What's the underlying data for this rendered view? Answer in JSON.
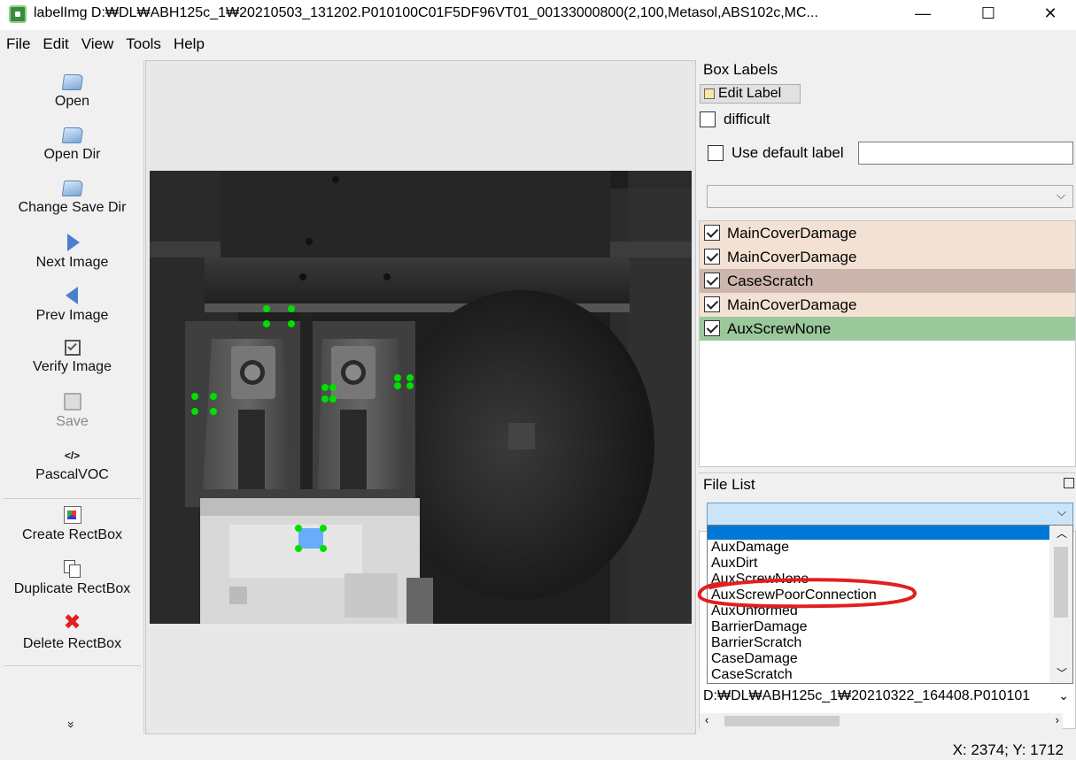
{
  "window": {
    "title": "labelImg D:₩DL₩ABH125c_1₩20210503_131202.P010100C01F5DF96VT01_00133000800(2,100,Metasol,ABS102c,MC...",
    "minimize": "—",
    "maximize": "☐",
    "close": "✕"
  },
  "menu": [
    "File",
    "Edit",
    "View",
    "Tools",
    "Help"
  ],
  "toolbar": {
    "open": "Open",
    "open_dir": "Open Dir",
    "change_save_dir": "Change Save Dir",
    "next_image": "Next Image",
    "prev_image": "Prev Image",
    "verify_image": "Verify Image",
    "save": "Save",
    "format_icon": "</>",
    "format": "PascalVOC",
    "create_rectbox": "Create RectBox",
    "duplicate_rectbox": "Duplicate RectBox",
    "delete_rectbox": "Delete RectBox",
    "expand": "»"
  },
  "box_labels": {
    "title": "Box Labels",
    "edit_label": "Edit Label",
    "difficult": "difficult",
    "use_default_label": "Use default label",
    "default_label_value": "",
    "labels": [
      {
        "text": "MainCoverDamage",
        "checked": true,
        "color": "#f3e2d4"
      },
      {
        "text": "MainCoverDamage",
        "checked": true,
        "color": "#f3e2d4"
      },
      {
        "text": "CaseScratch",
        "checked": true,
        "color": "#cbb5ad"
      },
      {
        "text": "MainCoverDamage",
        "checked": true,
        "color": "#f3e2d4"
      },
      {
        "text": "AuxScrewNone",
        "checked": true,
        "color": "#9bc89b"
      }
    ]
  },
  "file_list": {
    "title": "File List",
    "combo_value": "",
    "dropdown_options": [
      "AuxDamage",
      "AuxDirt",
      "AuxScrewNone",
      "AuxScrewPoorConnection",
      "AuxUnformed",
      "BarrierDamage",
      "BarrierScratch",
      "CaseDamage",
      "CaseScratch"
    ],
    "highlighted_option": "AuxScrewPoorConnection",
    "file_path": "D:₩DL₩ABH125c_1₩20210322_164408.P010101"
  },
  "status": {
    "coords": "X: 2374; Y: 1712"
  },
  "colors": {
    "point_green": "#00e000",
    "selected_box": "#4a9eff",
    "annotation_red": "#e02020",
    "combo_highlight": "#cce4f7",
    "dropdown_selected": "#0078d7"
  }
}
